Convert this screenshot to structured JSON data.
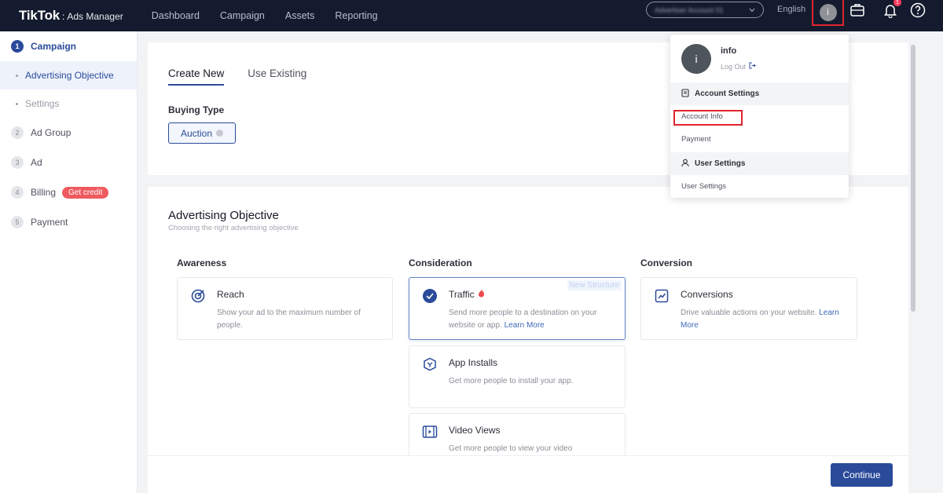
{
  "brand": {
    "logo": "TikTok",
    "separator": ":",
    "product": "Ads Manager"
  },
  "topnav": [
    "Dashboard",
    "Campaign",
    "Assets",
    "Reporting"
  ],
  "header": {
    "account_selector": "Advertiser Account 01",
    "language": "English",
    "avatar_letter": "i",
    "notification_count": "1"
  },
  "sidebar": {
    "steps": [
      {
        "num": "1",
        "label": "Campaign"
      },
      {
        "num": "2",
        "label": "Ad Group"
      },
      {
        "num": "3",
        "label": "Ad"
      },
      {
        "num": "4",
        "label": "Billing",
        "badge": "Get credit"
      },
      {
        "num": "5",
        "label": "Payment"
      }
    ],
    "substeps": [
      "Advertising Objective",
      "Settings"
    ]
  },
  "campaign": {
    "tabs": [
      "Create New",
      "Use Existing"
    ],
    "buying_type_label": "Buying Type",
    "buying_type_value": "Auction"
  },
  "objective": {
    "title": "Advertising Objective",
    "subtitle": "Choosing the right advertising objective",
    "columns": [
      "Awareness",
      "Consideration",
      "Conversion"
    ],
    "cards": {
      "reach": {
        "title": "Reach",
        "desc": "Show your ad to the maximum number of people."
      },
      "traffic": {
        "title": "Traffic",
        "desc": "Send more people to a destination on your website or app.",
        "link": "Learn More",
        "tag": "New Structure"
      },
      "conversions": {
        "title": "Conversions",
        "desc": "Drive valuable actions on your website.",
        "link": "Learn More"
      },
      "app_installs": {
        "title": "App Installs",
        "desc": "Get more people to install your app."
      },
      "video_views": {
        "title": "Video Views",
        "desc": "Get more people to view your video"
      }
    }
  },
  "footer": {
    "continue_label": "Continue"
  },
  "dropdown": {
    "name": "info",
    "logout": "Log Out",
    "account_settings": "Account Settings",
    "account_info": "Account Info",
    "payment": "Payment",
    "user_settings_section": "User Settings",
    "user_settings_item": "User Settings"
  },
  "colors": {
    "topbar": "#141b2e",
    "accent": "#2a4b9a",
    "highlight": "#e0242e",
    "credit": "#ee5a5e"
  }
}
